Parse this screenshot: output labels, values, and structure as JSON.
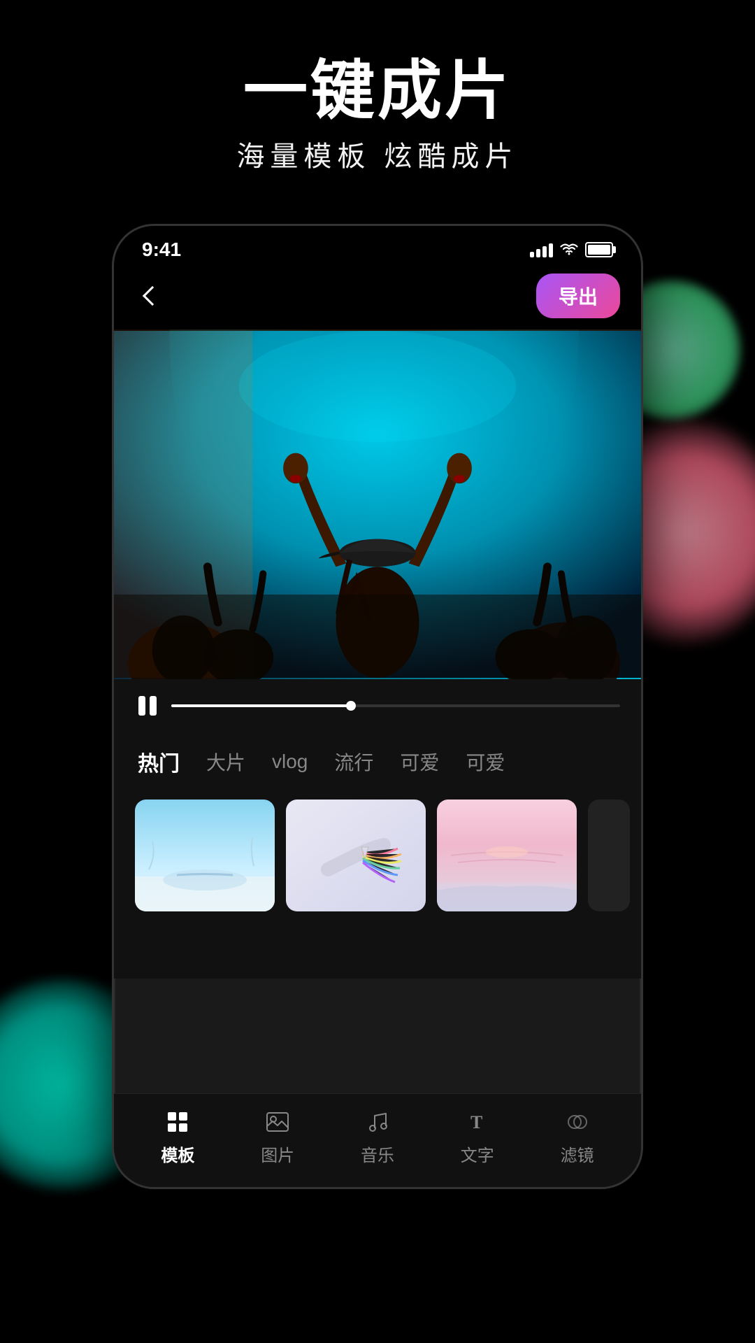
{
  "page": {
    "background": "#000000"
  },
  "header": {
    "main_title": "一键成片",
    "sub_title": "海量模板   炫酷成片"
  },
  "status_bar": {
    "time": "9:41",
    "signal_label": "signal",
    "wifi_label": "wifi",
    "battery_label": "battery"
  },
  "nav": {
    "back_label": "back",
    "export_label": "导出"
  },
  "playback": {
    "pause_label": "pause"
  },
  "category_tabs": [
    {
      "id": "hot",
      "label": "热门",
      "active": true
    },
    {
      "id": "bigshot",
      "label": "大片",
      "active": false
    },
    {
      "id": "vlog",
      "label": "vlog",
      "active": false
    },
    {
      "id": "popular",
      "label": "流行",
      "active": false
    },
    {
      "id": "cute1",
      "label": "可爱",
      "active": false
    },
    {
      "id": "cute2",
      "label": "可爱",
      "active": false
    }
  ],
  "templates": [
    {
      "id": "t1",
      "style": "sky"
    },
    {
      "id": "t2",
      "style": "rainbow"
    },
    {
      "id": "t3",
      "style": "sunset"
    },
    {
      "id": "t4",
      "style": "partial"
    }
  ],
  "bottom_nav": [
    {
      "id": "template",
      "label": "模板",
      "active": true,
      "icon": "template-icon"
    },
    {
      "id": "image",
      "label": "图片",
      "active": false,
      "icon": "image-icon"
    },
    {
      "id": "music",
      "label": "音乐",
      "active": false,
      "icon": "music-icon"
    },
    {
      "id": "text",
      "label": "文字",
      "active": false,
      "icon": "text-icon"
    },
    {
      "id": "filter",
      "label": "滤镜",
      "active": false,
      "icon": "filter-icon"
    }
  ]
}
